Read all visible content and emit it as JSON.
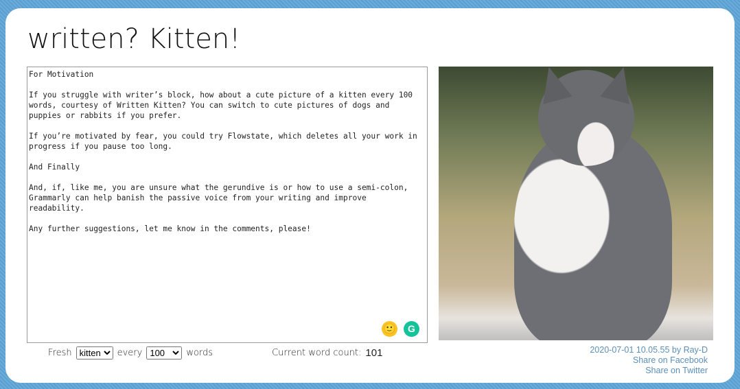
{
  "title": "written? Kitten!",
  "editor_text": "For Motivation\n\nIf you struggle with writer’s block, how about a cute picture of a kitten every 100 words, courtesy of Written Kitten? You can switch to cute pictures of dogs and puppies or rabbits if you prefer.\n\nIf you’re motivated by fear, you could try Flowstate, which deletes all your work in progress if you pause too long.\n\nAnd Finally\n\nAnd, if, like me, you are unsure what the gerundive is or how to use a semi-colon, Grammarly can help banish the passive voice from your writing and improve readability.\n\nAny further suggestions, let me know in the comments, please!",
  "footer": {
    "fresh_label": "Fresh",
    "animal_selected": "kitten",
    "every_label": "every",
    "words_selected": "100",
    "words_label": "words",
    "count_label": "Current word count:",
    "count_value": "101"
  },
  "photo": {
    "credit": "2020-07-01 10.05.55 by Ray-D"
  },
  "share": {
    "facebook": "Share on Facebook",
    "twitter": "Share on Twitter"
  },
  "icons": {
    "emoji": "smiley-icon",
    "grammarly": "grammarly-icon"
  },
  "colors": {
    "background": "#5fa3d3",
    "link": "#5b8fb9"
  }
}
